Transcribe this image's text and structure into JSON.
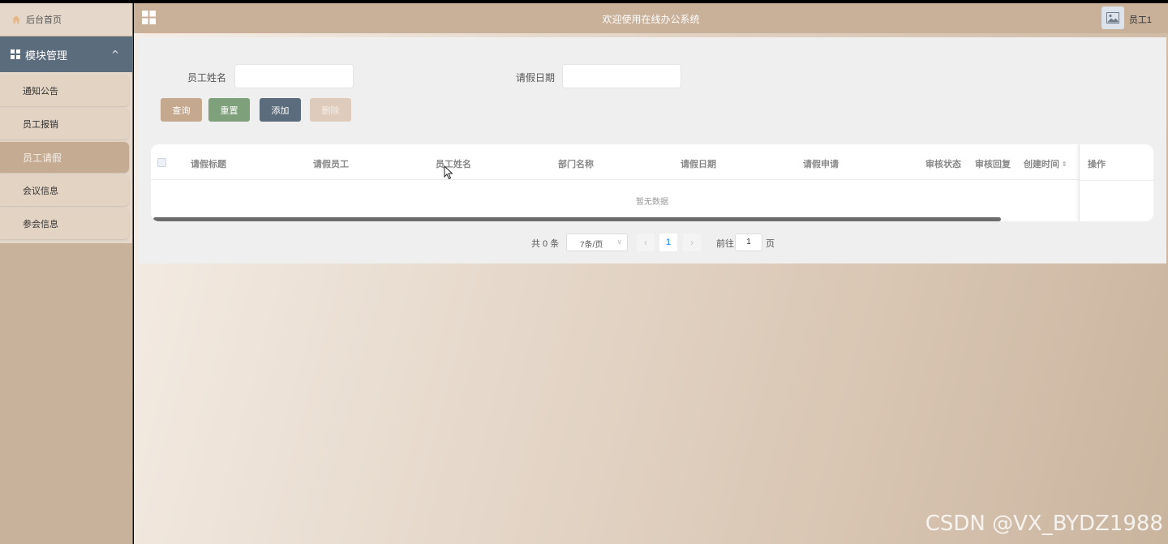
{
  "sidebar": {
    "home": "后台首页",
    "module": "模块管理",
    "items": [
      {
        "label": "通知公告"
      },
      {
        "label": "员工报销"
      },
      {
        "label": "员工请假"
      },
      {
        "label": "会议信息"
      },
      {
        "label": "参会信息"
      }
    ],
    "active_index": 2
  },
  "header": {
    "title": "欢迎使用在线办公系统",
    "user": "员工1"
  },
  "search": {
    "name_label": "员工姓名",
    "name_value": "",
    "date_label": "请假日期",
    "date_value": ""
  },
  "buttons": {
    "query": "查询",
    "reset": "重置",
    "add": "添加",
    "delete": "删除"
  },
  "table": {
    "columns": [
      "请假标题",
      "请假员工",
      "员工姓名",
      "部门名称",
      "请假日期",
      "请假申请",
      "审核状态",
      "审核回复",
      "创建时间"
    ],
    "action_column": "操作",
    "empty_text": "暂无数据"
  },
  "pagination": {
    "total": "共 0 条",
    "page_size": "7条/页",
    "current_page": "1",
    "goto_label": "前往",
    "goto_value": "1",
    "goto_unit": "页"
  },
  "watermark": "CSDN @VX_BYDZ1988",
  "colors": {
    "sidebar_bg": "#c8b29b",
    "module_bg": "#5b6c7c",
    "header_bg": "#c9b098",
    "btn_query": "#c4a98e",
    "btn_reset": "#7ea07a",
    "btn_add": "#5b6c7c",
    "btn_delete": "#dfcbbb",
    "accent": "#409eff"
  }
}
